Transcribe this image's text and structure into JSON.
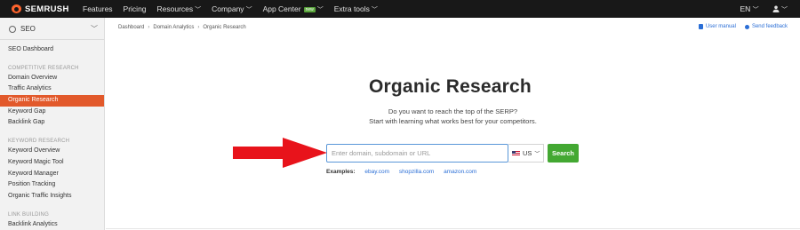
{
  "topbar": {
    "logo_text": "SEMRUSH",
    "nav": [
      {
        "label": "Features",
        "dropdown": false
      },
      {
        "label": "Pricing",
        "dropdown": false
      },
      {
        "label": "Resources",
        "dropdown": true
      },
      {
        "label": "Company",
        "dropdown": true
      },
      {
        "label": "App Center",
        "dropdown": true,
        "badge": "new"
      },
      {
        "label": "Extra tools",
        "dropdown": true
      }
    ],
    "lang": "EN",
    "user_icon": "user-icon"
  },
  "sidebar": {
    "header": "SEO",
    "items": [
      {
        "type": "item",
        "label": "SEO Dashboard"
      },
      {
        "type": "section",
        "label": "COMPETITIVE RESEARCH"
      },
      {
        "type": "item",
        "label": "Domain Overview"
      },
      {
        "type": "item",
        "label": "Traffic Analytics"
      },
      {
        "type": "item",
        "label": "Organic Research",
        "active": true
      },
      {
        "type": "item",
        "label": "Keyword Gap"
      },
      {
        "type": "item",
        "label": "Backlink Gap"
      },
      {
        "type": "section",
        "label": "KEYWORD RESEARCH"
      },
      {
        "type": "item",
        "label": "Keyword Overview"
      },
      {
        "type": "item",
        "label": "Keyword Magic Tool"
      },
      {
        "type": "item",
        "label": "Keyword Manager"
      },
      {
        "type": "item",
        "label": "Position Tracking"
      },
      {
        "type": "item",
        "label": "Organic Traffic Insights"
      },
      {
        "type": "section",
        "label": "LINK BUILDING"
      },
      {
        "type": "item",
        "label": "Backlink Analytics"
      }
    ]
  },
  "main": {
    "breadcrumb": [
      "Dashboard",
      "Domain Analytics",
      "Organic Research"
    ],
    "user_manual": "User manual",
    "send_feedback": "Send feedback",
    "title": "Organic Research",
    "subtitle_1": "Do you want to reach the top of the SERP?",
    "subtitle_2": "Start with learning what works best for your competitors.",
    "search": {
      "placeholder": "Enter domain, subdomain or URL",
      "value": "",
      "database": "US",
      "button": "Search"
    },
    "examples_label": "Examples:",
    "examples": [
      "ebay.com",
      "shopzilla.com",
      "amazon.com"
    ]
  },
  "colors": {
    "topbar_bg": "#181818",
    "brand": "#ff642d",
    "active_item": "#e2592b",
    "search_button": "#43a832",
    "link": "#2a6ed6",
    "annotation_arrow": "#e8131b"
  }
}
